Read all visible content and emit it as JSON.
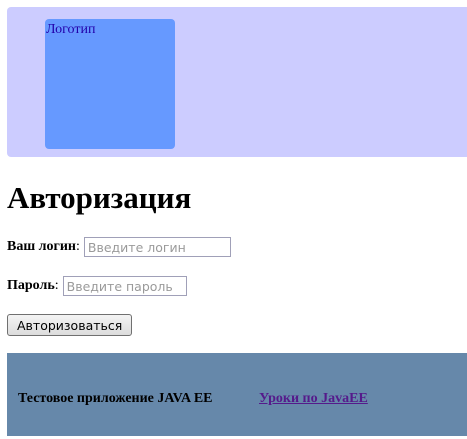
{
  "header": {
    "logo_text": "Логотип"
  },
  "page": {
    "title": "Авторизация"
  },
  "form": {
    "login_label": "Ваш логин",
    "login_placeholder": "Введите логин",
    "login_value": "",
    "password_label": "Пароль",
    "password_placeholder": "Введите пароль",
    "password_value": "",
    "submit_label": "Авторизоваться"
  },
  "footer": {
    "text": "Тестовое приложение JAVA EE",
    "link_text": "Уроки по JavaEE"
  }
}
